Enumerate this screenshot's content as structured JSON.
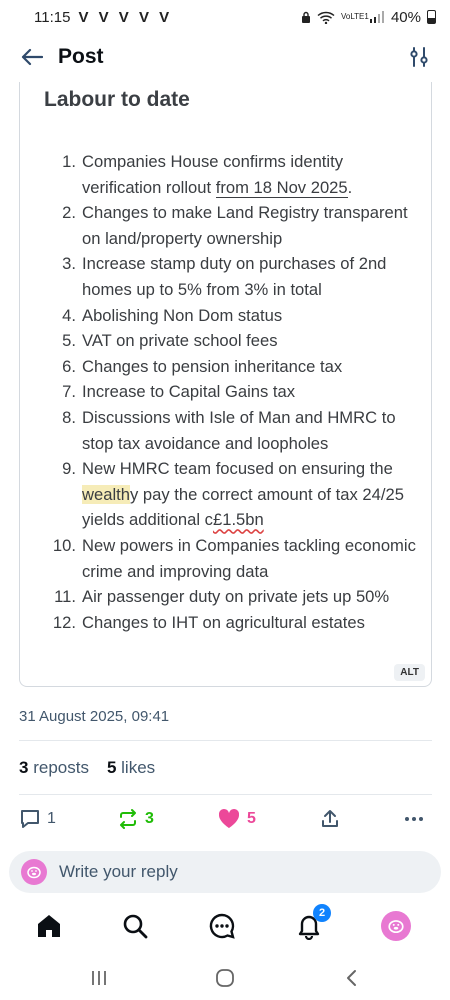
{
  "status_bar": {
    "time": "11:15",
    "notifications": "V V V V V",
    "signal_label": "VoLTE1",
    "battery": "40%"
  },
  "header": {
    "title": "Post",
    "back_icon": "arrow-left-icon",
    "filter_icon": "sliders-icon"
  },
  "image": {
    "heading": "Labour to date",
    "alt_badge": "ALT",
    "items": [
      {
        "num": "1.",
        "text": "Companies House confirms identity verification rollout ",
        "underlined": "from 18 Nov 2025",
        "tail": "."
      },
      {
        "num": "2.",
        "text": "Changes to make Land Registry transparent on land/property ownership"
      },
      {
        "num": "3.",
        "text": "Increase stamp duty on purchases of 2nd homes up to 5% from 3% in total"
      },
      {
        "num": "4.",
        "text": "Abolishing Non Dom status"
      },
      {
        "num": "5.",
        "text": "VAT on private school fees"
      },
      {
        "num": "6.",
        "text": "Changes to pension inheritance tax"
      },
      {
        "num": "7.",
        "text": "Increase to Capital Gains tax"
      },
      {
        "num": "8.",
        "text": "Discussions with Isle of Man and HMRC to stop tax avoidance and loopholes"
      },
      {
        "num": "9.",
        "pre": "New HMRC team focused on ensuring the ",
        "highlight": "wealth",
        "post": "y pay the correct amount of tax 24/25 yields additional c",
        "squiggle": "£1.5bn"
      },
      {
        "num": "10.",
        "text": "New powers in Companies tackling economic crime and improving data"
      },
      {
        "num": "11.",
        "text": "Air passenger duty on private jets up 50%"
      },
      {
        "num": "12.",
        "text": "Changes to IHT on agricultural estates"
      }
    ]
  },
  "post": {
    "date": "31 August 2025, 09:41",
    "reposts_count": "3",
    "reposts_label": "reposts",
    "likes_count": "5",
    "likes_label": "likes"
  },
  "actions": {
    "reply_count": "1",
    "repost_count": "3",
    "like_count": "5"
  },
  "reply": {
    "placeholder": "Write your reply"
  },
  "bottom_nav": {
    "notification_badge": "2"
  },
  "colors": {
    "accent": "#1083fe",
    "repost_green": "#20bc07",
    "like_pink": "#ec4899",
    "avatar_pink": "#e879d2",
    "muted": "#42576c"
  }
}
